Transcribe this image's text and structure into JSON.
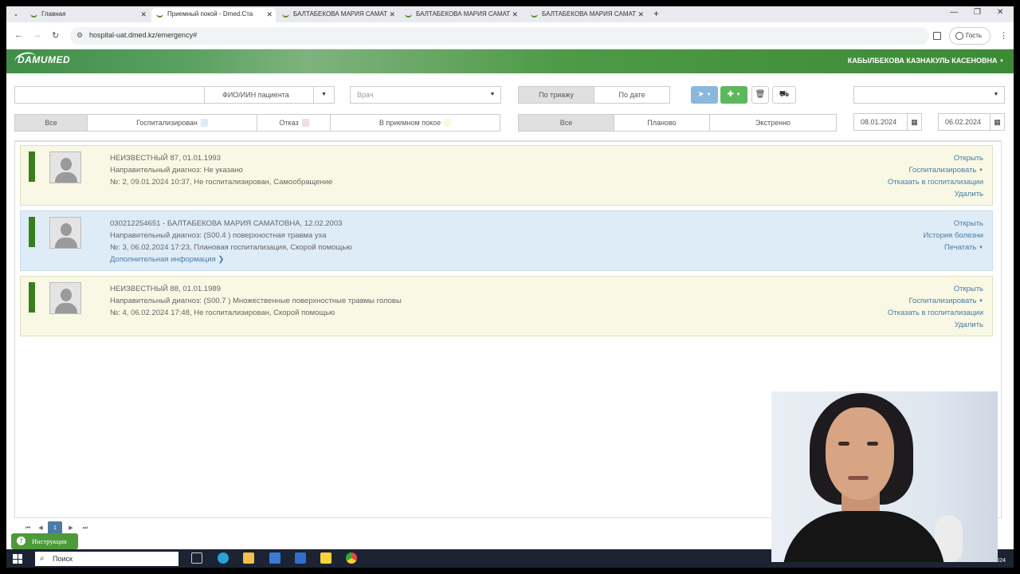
{
  "browser": {
    "tabs": [
      {
        "title": "Главная"
      },
      {
        "title": "Приемный покой - Dmed.Ста"
      },
      {
        "title": "БАЛТАБЕКОВА МАРИЯ САМАТ"
      },
      {
        "title": "БАЛТАБЕКОВА МАРИЯ САМАТ"
      },
      {
        "title": "БАЛТАБЕКОВА МАРИЯ САМАТ"
      }
    ],
    "url": "hospital-uat.dmed.kz/emergency#",
    "profile_label": "Гость"
  },
  "header": {
    "logo": "DAMUMED",
    "user": "КАБЫЛБЕКОВА КАЗНАКУЛЬ КАСЕНОВНА"
  },
  "filters": {
    "patient_select": "ФИО/ИИН пациента",
    "doctor_placeholder": "Врач",
    "sort_triage": "По триажу",
    "sort_date": "По дате",
    "status_all": "Все",
    "status_hospitalized": "Госпитализирован",
    "status_refused": "Отказ",
    "status_in_er": "В приемном покое",
    "type_all": "Все",
    "type_planned": "Планово",
    "type_emergency": "Экстренно",
    "date_from": "08.01.2024",
    "date_to": "06.02.2024",
    "colors": {
      "hospitalized": "#deecf7",
      "refused": "#f1dede",
      "in_er": "#f8f8e4"
    }
  },
  "patients": [
    {
      "name": "НЕИЗВЕСТНЫЙ 87, 01.01.1993",
      "diagnosis": "Направительный диагноз: Не указано",
      "info": "№: 2, 09.01.2024 10:37, Не госпитализирован, Самообращение",
      "actions": [
        "Открыть",
        "Госпитализировать",
        "Отказать в госпитализации",
        "Удалить"
      ]
    },
    {
      "name": "030212254651 - БАЛТАБЕКОВА МАРИЯ САМАТОВНА, 12.02.2003",
      "diagnosis": "Направительный диагноз: (S00.4 ) поверхностная травма уха",
      "info": "№: 3, 06.02.2024 17:23, Плановая госпитализация, Скорой помощью",
      "more": "Дополнительная информация",
      "actions": [
        "Открыть",
        "История болезни",
        "Печатать"
      ]
    },
    {
      "name": "НЕИЗВЕСТНЫЙ 88, 01.01.1989",
      "diagnosis": "Направительный диагноз: (S00.7 ) Множественные поверхностные травмы головы",
      "info": "№: 4, 06.02.2024 17:48, Не госпитализирован, Скорой помощью",
      "actions": [
        "Открыть",
        "Госпитализировать",
        "Отказать в госпитализации",
        "Удалить"
      ]
    }
  ],
  "pagination": {
    "current": "1"
  },
  "help_button": "Инструкция",
  "taskbar": {
    "search": "Поиск",
    "date": "06.02.2024"
  }
}
